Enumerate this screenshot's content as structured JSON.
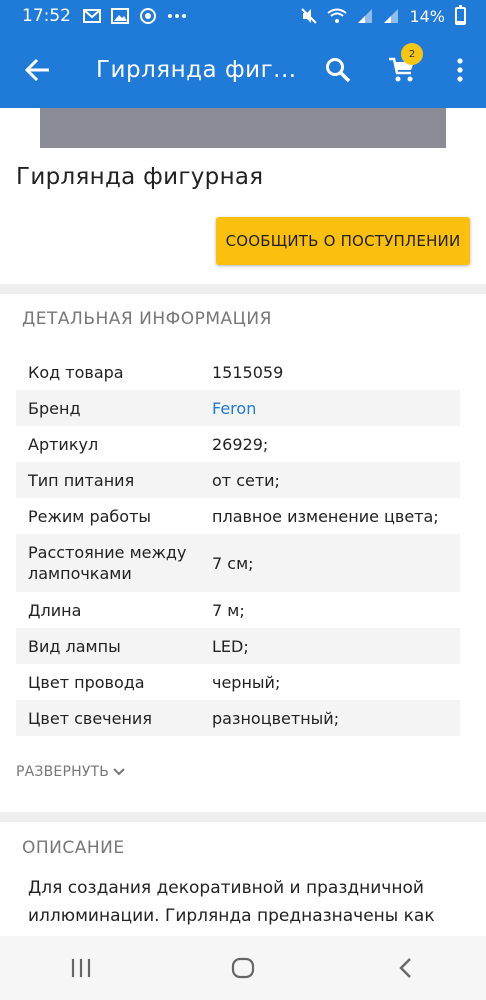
{
  "status_bar": {
    "time": "17:52",
    "battery": "14%",
    "battery_level": 0.14
  },
  "app_bar": {
    "title": "Гирлянда фиг...",
    "cart_count": "2"
  },
  "product": {
    "title": "Гирлянда фигурная",
    "notify_button": "СООБЩИТЬ О ПОСТУПЛЕНИИ"
  },
  "details": {
    "heading": "ДЕТАЛЬНАЯ ИНФОРМАЦИЯ",
    "rows": [
      {
        "key": "Код товара",
        "value": "1515059"
      },
      {
        "key": "Бренд",
        "value": "Feron"
      },
      {
        "key": "Артикул",
        "value": "26929;"
      },
      {
        "key": "Тип питания",
        "value": "от сети;"
      },
      {
        "key": "Режим работы",
        "value": "плавное изменение цвета;"
      },
      {
        "key": "Расстояние между лампочками",
        "value": "7 см;"
      },
      {
        "key": "Длина",
        "value": "7 м;"
      },
      {
        "key": "Вид лампы",
        "value": "LED;"
      },
      {
        "key": "Цвет провода",
        "value": "черный;"
      },
      {
        "key": "Цвет свечения",
        "value": "разноцветный;"
      }
    ],
    "expand_label": "РАЗВЕРНУТЬ"
  },
  "description": {
    "heading": "ОПИСАНИЕ",
    "text": "Для создания декоративной и праздничной иллюминации. Гирлянда предназначены как"
  },
  "colors": {
    "primary": "#1f7ad8",
    "accent": "#fbbf0f",
    "badge": "#f5c518"
  }
}
